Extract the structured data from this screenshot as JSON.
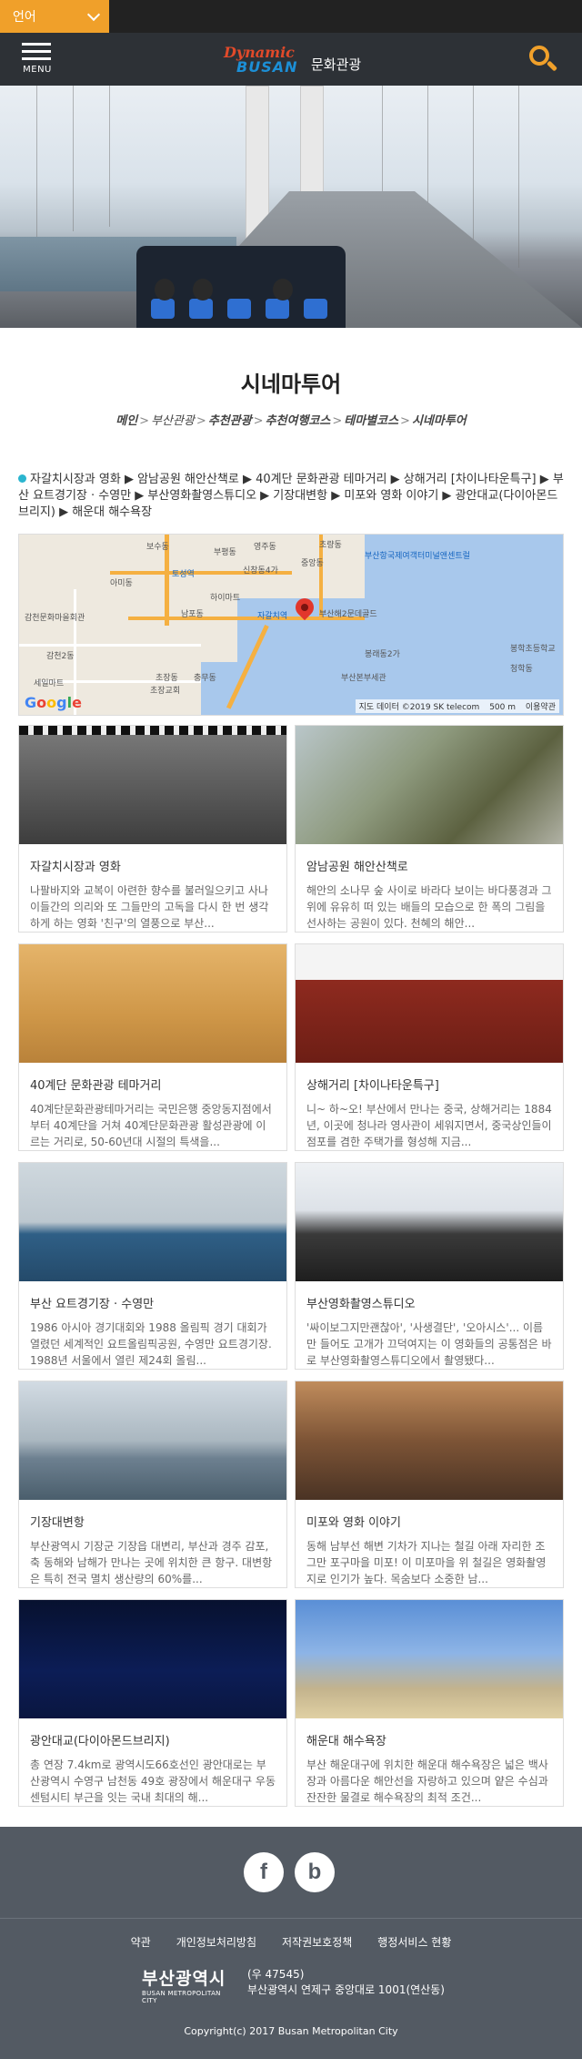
{
  "topbar": {
    "language_label": "언어"
  },
  "header": {
    "menu_label": "MENU",
    "logo_line1": "Dynamic",
    "logo_line2": "BUSAN",
    "site_title": "문화관광"
  },
  "page": {
    "title": "시네마투어",
    "breadcrumb": [
      {
        "label": "메인",
        "bold": true
      },
      {
        "label": "부산관광",
        "bold": false
      },
      {
        "label": "추천관광",
        "bold": true
      },
      {
        "label": "추천여행코스",
        "bold": true
      },
      {
        "label": "테마별코스",
        "bold": true
      },
      {
        "label": "시네마투어",
        "bold": true
      }
    ],
    "breadcrumb_sep": ">"
  },
  "route": {
    "text": "자갈치시장과 영화 ▶ 암남공원 해안산책로 ▶ 40계단 문화관광 테마거리 ▶ 상해거리 [차이나타운특구] ▶ 부산 요트경기장 · 수영만 ▶ 부산영화촬영스튜디오 ▶ 기장대변항 ▶ 미포와 영화 이야기 ▶ 광안대교(다이아몬드브리지) ▶ 해운대 해수욕장"
  },
  "map": {
    "labels": [
      "신창동4가",
      "부평동",
      "보수동",
      "토성역",
      "아미동",
      "하이마트",
      "중앙동",
      "자갈치역",
      "남포동",
      "부산해2문데골드",
      "감천문화마을회관",
      "감천2동",
      "세일마트",
      "초장동",
      "충무동",
      "부산항국제여객터미널앤센트럴",
      "영주동",
      "초량동",
      "봉래동2가",
      "부산본부세관",
      "청학동",
      "봉학초등학교",
      "초장교회"
    ],
    "attribution": "지도 데이터 ©2019 SK telecom",
    "scale": "500 m",
    "terms": "이용약관",
    "brand": "Google"
  },
  "cards": [
    {
      "title": "자갈치시장과 영화",
      "desc": "나팔바지와 교복이 아련한 향수를 불러일으키고 사나이들간의 의리와 또 그들만의 고독을 다시 한 번 생각하게 하는 영화 '친구'의 열풍으로 부산...",
      "image": "film"
    },
    {
      "title": "암남공원 해안산책로",
      "desc": "해안의 소나무 숲 사이로 바라다 보이는 바다풍경과 그 위에 유유히 떠 있는 배들의 모습으로 한 폭의 그림을 선사하는 공원이 있다. 천혜의 해안...",
      "image": "rock"
    },
    {
      "title": "40계단 문화관광 테마거리",
      "desc": "40계단문화관광테마거리는 국민은행 중앙동지점에서부터 40계단을 거쳐 40계단문화관광 활성관광에 이르는 거리로, 50-60년대 시절의 특색을...",
      "image": "sepia"
    },
    {
      "title": "상해거리 [차이나타운특구]",
      "desc": "니~ 하~오! 부산에서 만나는 중국, 상해거리는 1884년, 이곳에 청나라 영사관이 세워지면서, 중국상인들이 점포를 겸한 주택가를 형성해 지금...",
      "image": "china"
    },
    {
      "title": "부산 요트경기장 · 수영만",
      "desc": "1986 아시아 경기대회와 1988 올림픽 경기 대회가 열렸던 세계적인 요트올림픽공원, 수영만 요트경기장. 1988년 서울에서 열린 제24회 올림...",
      "image": "yacht"
    },
    {
      "title": "부산영화촬영스튜디오",
      "desc": "'싸이보그지만괜찮아', '사생결단', '오아시스'... 이름만 들어도 고개가 끄덕여지는 이 영화들의 공통점은 바로 부산영화촬영스튜디오에서 촬영됐다...",
      "image": "studio"
    },
    {
      "title": "기장대변항",
      "desc": "부산광역시 기장군 기장읍 대변리, 부산과 경주 감포, 축 동해와 남해가 만나는 곳에 위치한 큰 항구. 대변항은 특히 전국 멸치 생산량의 60%를...",
      "image": "harbor"
    },
    {
      "title": "미포와 영화 이야기",
      "desc": "동해 남부선 해변 기차가 지나는 철길 아래 자리한 조그만 포구마을 미포! 이 미포마을 위 철길은 영화촬영지로 인기가 높다. 목숨보다 소중한 남...",
      "image": "street"
    },
    {
      "title": "광안대교(다이아몬드브리지)",
      "desc": "총 연장 7.4km로 광역시도66호선인 광안대로는 부산광역시 수영구 남천동 49호 광장에서 해운대구 우동 센텀시티 부근을 잇는 국내 최대의 해...",
      "image": "night"
    },
    {
      "title": "해운대 해수욕장",
      "desc": "부산 해운대구에 위치한 해운대 해수욕장은 넓은 백사장과 아름다운 해안선을 자랑하고 있으며 얕은 수심과 잔잔한 물결로 해수욕장의 최적 조건...",
      "image": "beach"
    }
  ],
  "footer": {
    "social": [
      {
        "label": "f",
        "icon": "facebook-icon"
      },
      {
        "label": "b",
        "icon": "blog-icon"
      }
    ],
    "links": [
      "약관",
      "개인정보처리방침",
      "저작권보호정책",
      "행정서비스 현황"
    ],
    "logo_kr": "부산광역시",
    "logo_en": "BUSAN METROPOLITAN CITY",
    "postcode": "(우 47545)",
    "address": "부산광역시 연제구 중앙대로 1001(연산동)",
    "copyright": "Copyright(c) 2017 Busan Metropolitan City"
  },
  "colors": {
    "accent": "#f0a02a",
    "header_bg": "#2d3136",
    "footer_bg": "#535a63",
    "route_dot": "#2ab5cf"
  }
}
